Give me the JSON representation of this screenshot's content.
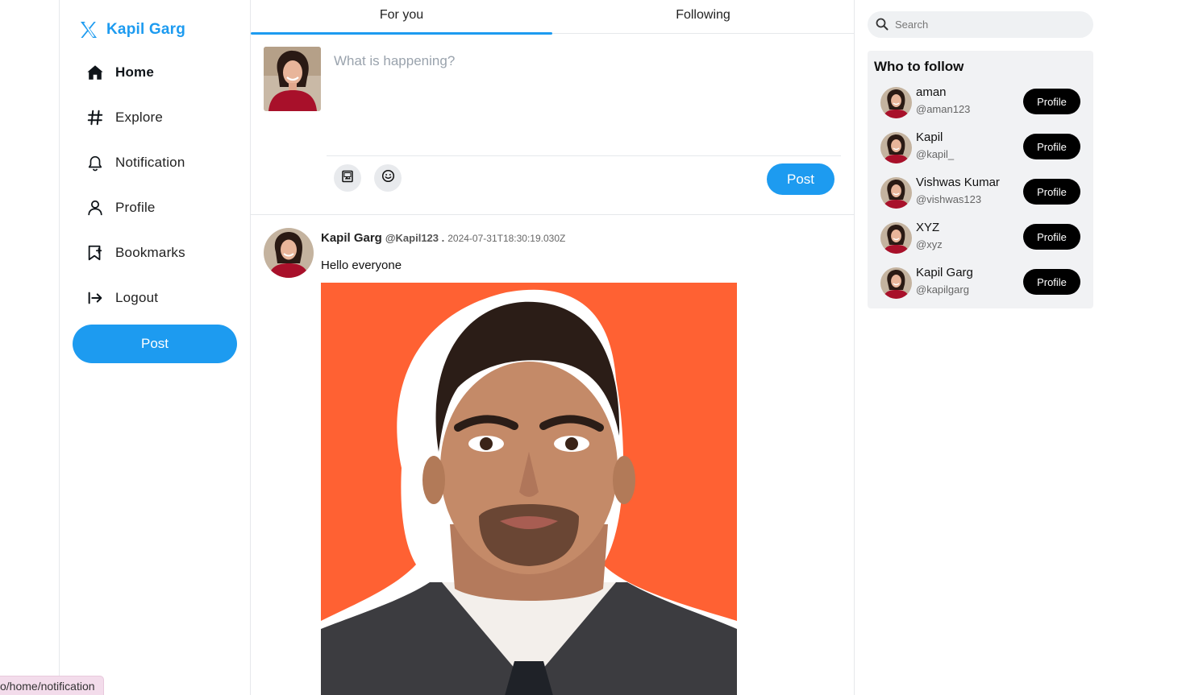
{
  "brand": {
    "name": "Kapil Garg",
    "icon": "x-logo-icon"
  },
  "nav": {
    "items": [
      {
        "label": "Home",
        "icon": "home-icon",
        "active": true
      },
      {
        "label": "Explore",
        "icon": "hashtag-icon"
      },
      {
        "label": "Notification",
        "icon": "bell-icon"
      },
      {
        "label": "Profile",
        "icon": "user-icon"
      },
      {
        "label": "Bookmarks",
        "icon": "bookmark-icon"
      },
      {
        "label": "Logout",
        "icon": "logout-icon"
      }
    ],
    "post_label": "Post"
  },
  "tabs": [
    {
      "label": "For you",
      "active": true
    },
    {
      "label": "Following",
      "active": false
    }
  ],
  "composer": {
    "placeholder": "What is happening?",
    "tools": [
      "image-icon",
      "emoji-icon"
    ],
    "post_label": "Post"
  },
  "tweet": {
    "name": "Kapil Garg",
    "handle": "@Kapil123 .",
    "timestamp": "2024-07-31T18:30:19.030Z",
    "text": "Hello everyone"
  },
  "search": {
    "placeholder": "Search"
  },
  "who_to_follow": {
    "title": "Who to follow",
    "button_label": "Profile",
    "users": [
      {
        "name": "aman",
        "handle": "@aman123"
      },
      {
        "name": "Kapil",
        "handle": "@kapil_"
      },
      {
        "name": "Vishwas Kumar",
        "handle": "@vishwas123"
      },
      {
        "name": "XYZ",
        "handle": "@xyz"
      },
      {
        "name": "Kapil Garg",
        "handle": "@kapilgarg"
      }
    ]
  },
  "status_bar": {
    "url": "o/home/notification"
  },
  "colors": {
    "accent": "#1d9bf0",
    "image_bg": "#ff6133",
    "follow_button": "#000000"
  }
}
